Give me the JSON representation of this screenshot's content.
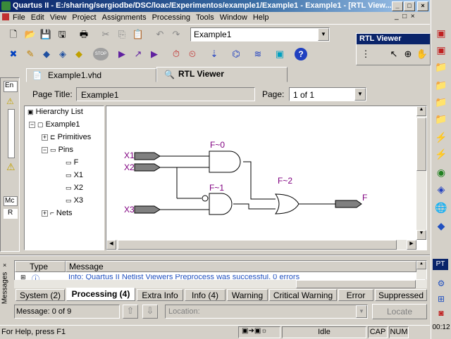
{
  "window": {
    "title": "Quartus II - E:/sharing/sergiodbe/DSC/loac/Experimentos/example1/Example1 - Example1 - [RTL View..."
  },
  "menu": [
    "File",
    "Edit",
    "View",
    "Project",
    "Assignments",
    "Processing",
    "Tools",
    "Window",
    "Help"
  ],
  "toolbar": {
    "project_select": "Example1"
  },
  "rtl_palette": {
    "title": "RTL Viewer"
  },
  "tabs": [
    {
      "label": "Example1.vhd"
    },
    {
      "label": "RTL Viewer"
    }
  ],
  "page": {
    "title_label": "Page Title:",
    "title_value": "Example1",
    "page_label": "Page:",
    "page_value": "1 of 1"
  },
  "hierarchy": {
    "header": "Hierarchy List",
    "items": [
      "Example1",
      "Primitives",
      "Pins",
      "F",
      "X1",
      "X2",
      "X3",
      "Nets"
    ]
  },
  "schematic": {
    "inputs": [
      "X1",
      "X2",
      "X3"
    ],
    "output": "F",
    "gates": [
      "F~0",
      "F~1",
      "F~2"
    ]
  },
  "messages": {
    "col_type": "Type",
    "col_message": "Message",
    "row_text": "Info: Quartus II Netlist Viewers Preprocess was successful. 0 errors",
    "side_label": "Messages",
    "tabs": [
      "System (2)",
      "Processing (4)",
      "Extra Info",
      "Info (4)",
      "Warning",
      "Critical Warning",
      "Error",
      "Suppressed"
    ],
    "count": "Message: 0 of 9",
    "location_placeholder": "Location:",
    "locate_button": "Locate"
  },
  "statusbar": {
    "help": "For Help, press F1",
    "state": "Idle",
    "cap": "CAP",
    "num": "NUM"
  },
  "left_panel": {
    "label_e": "En",
    "label_m": "Mc",
    "label_r": "R"
  },
  "taskbar": {
    "lang": "PT",
    "clock": "00:12"
  },
  "colors": {
    "title_start": "#0a246a",
    "title_end": "#a6caf0",
    "pin_fill": "#808080",
    "pin_text": "#800080"
  }
}
